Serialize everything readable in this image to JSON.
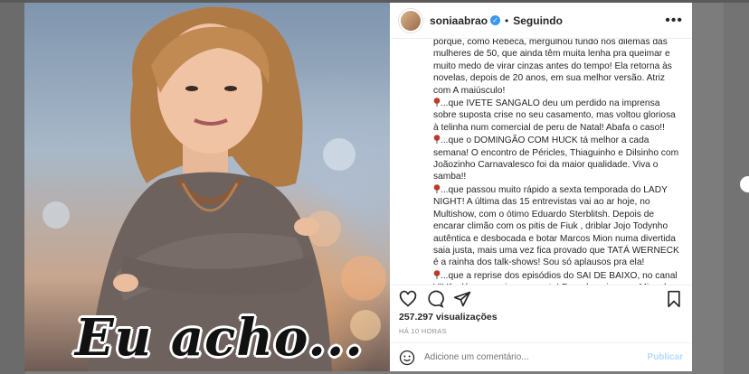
{
  "post": {
    "overlay_text": "Eu acho...",
    "username": "soniaabrao",
    "separator": "•",
    "follow_status": "Seguindo",
    "caption": [
      "porque, como Rebeca, mergulhou fundo nos dilemas das mulheres de 50, que ainda têm muita lenha pra queimar e muito medo de virar cinzas antes do tempo! Ela retorna às novelas, depois de 20 anos, em sua melhor versão. Atriz com A maiúsculo!",
      "...que IVETE SANGALO deu um perdido na imprensa sobre suposta crise no seu casamento, mas voltou gloriosa à telinha num comercial de peru de Natal! Abafa o caso!!",
      "...que o DOMINGÃO COM HUCK tá melhor a cada semana! O encontro de Péricles, Thiaguinho e Dilsinho com Joãozinho Carnavalesco foi da maior qualidade. Viva o samba!!",
      "...que passou muito rápido a sexta temporada do LADY NIGHT! A última das 15 entrevistas vai ao ar hoje, no Multishow, com o ótimo Eduardo Sterblitsh. Depois de encarar climão com os pitis de Fiuk , driblar Jojo Todynho autêntica e desbocada e botar Marcos Mion numa divertida saia justa, mais uma vez fica provado que TATÁ WERNECK é a rainha dos talk-shows! Sou só aplausos pra ela!",
      "...que a reprise dos episódios do SAI DE BAIXO, no canal VIVA, dá um respiro pra gente! Bom demais rever Miguel Falabella, Aracy Balabanian, Ary Fontoura, Marisa Orth, Tom Cavalcanti e Cláudia Jimenez, divertidíssimos em cena! Comovente ver Cláudia Rodrigues ainda em plena forma no palco e matar a saudade de"
    ],
    "views": "257.297 visualizações",
    "time": "HÁ 10 HORAS",
    "comment_placeholder": "Adicione um comentário...",
    "publish_label": "Publicar",
    "icons": {
      "like": "heart-icon",
      "comment": "comment-icon",
      "share": "share-icon",
      "save": "bookmark-icon",
      "emoji": "emoji-icon",
      "more": "more-icon",
      "verified": "verified-icon",
      "pin": "pin-icon"
    },
    "colors": {
      "verified": "#3897f0",
      "publish_disabled": "#b3dbff"
    }
  }
}
